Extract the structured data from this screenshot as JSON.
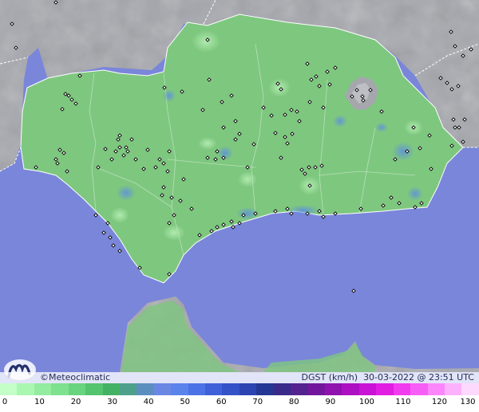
{
  "brand": {
    "name": "Meteoclimatic",
    "copyright": "©"
  },
  "map": {
    "colors": {
      "sea": "#7a86d9",
      "land_outside": "#a5a7ad",
      "region": "#7ec77f",
      "border": "#ffffff",
      "station": "#000000"
    }
  },
  "info": {
    "variable": "DGST (km/h)",
    "timestamp": "30-03-2022 @ 23:51 UTC"
  },
  "scale": {
    "unit": "km/h",
    "ticks": [
      "0",
      "10",
      "20",
      "30",
      "40",
      "50",
      "60",
      "70",
      "80",
      "90",
      "100",
      "110",
      "120",
      "130"
    ],
    "colors": [
      "#c4ffc8",
      "#a9f7b0",
      "#93eca0",
      "#7de18f",
      "#69d47f",
      "#55c46f",
      "#44b265",
      "#4ea08a",
      "#5c8fc0",
      "#6a87e3",
      "#5a83ec",
      "#4c73e6",
      "#3f60d9",
      "#3352c8",
      "#2c44b2",
      "#253794",
      "#3a2a8a",
      "#55238f",
      "#72179d",
      "#8f11ae",
      "#ad10c2",
      "#c913d6",
      "#e21ee3",
      "#f13bee",
      "#f75ef6",
      "#fb86fb",
      "#fdb1fc",
      "#fed9fe"
    ]
  }
}
